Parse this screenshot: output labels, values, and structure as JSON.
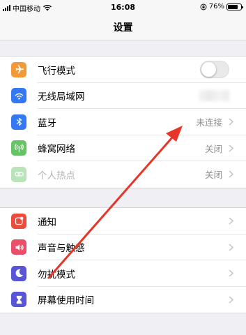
{
  "status_bar": {
    "carrier": "中国移动",
    "time": "16:08",
    "battery_text": "76%",
    "battery_level": 0.76
  },
  "nav": {
    "title": "设置"
  },
  "groups": [
    {
      "rows": [
        {
          "label": "飞行模式",
          "icon": "airplane-icon",
          "icon_color": "#f19a37",
          "control": "toggle",
          "toggle_on": false
        },
        {
          "label": "无线局域网",
          "icon": "wifi-icon",
          "icon_color": "#3478f6",
          "control": "blurred-value"
        },
        {
          "label": "蓝牙",
          "icon": "bluetooth-icon",
          "icon_color": "#3478f6",
          "value": "未连接",
          "control": "chevron"
        },
        {
          "label": "蜂窝网络",
          "icon": "cellular-antenna-icon",
          "icon_color": "#65c466",
          "value": "关闭",
          "control": "chevron"
        },
        {
          "label": "个人热点",
          "icon": "hotspot-link-icon",
          "icon_color": "#65c466",
          "value": "关闭",
          "control": "chevron",
          "dimmed": true
        }
      ]
    },
    {
      "rows": [
        {
          "label": "通知",
          "icon": "notification-icon",
          "icon_color": "#eb4d3d",
          "control": "chevron"
        },
        {
          "label": "声音与触感",
          "icon": "speaker-icon",
          "icon_color": "#eb4e69",
          "control": "chevron"
        },
        {
          "label": "勿扰模式",
          "icon": "moon-icon",
          "icon_color": "#5856d6",
          "control": "chevron"
        },
        {
          "label": "屏幕使用时间",
          "icon": "hourglass-icon",
          "icon_color": "#5856d6",
          "control": "chevron"
        }
      ]
    }
  ],
  "annotation": {
    "arrow_color": "#e8352a"
  }
}
